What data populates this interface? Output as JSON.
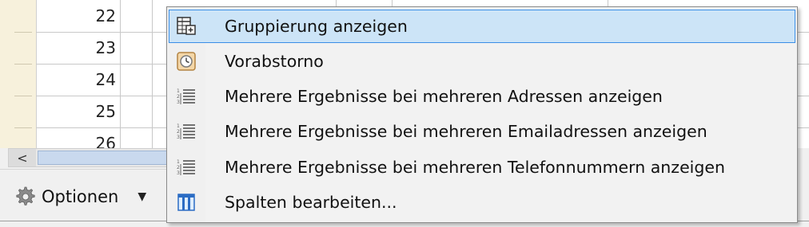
{
  "grid": {
    "rows": [
      {
        "num": "22"
      },
      {
        "num": "23"
      },
      {
        "num": "24"
      },
      {
        "num": "25"
      },
      {
        "num": "26"
      }
    ]
  },
  "toolbar": {
    "options_label": "Optionen",
    "options_icon": "gear-icon",
    "dropdown_icon": "caret-down-icon"
  },
  "scrollbar": {
    "left_arrow": "<"
  },
  "context_menu": {
    "items": [
      {
        "label": "Gruppierung anzeigen",
        "icon": "grouping-icon",
        "highlighted": true
      },
      {
        "label": "Vorabstorno",
        "icon": "storno-icon",
        "highlighted": false
      },
      {
        "label": "Mehrere Ergebnisse bei mehreren Adressen anzeigen",
        "icon": "list-icon",
        "highlighted": false
      },
      {
        "label": "Mehrere Ergebnisse bei mehreren Emailadressen anzeigen",
        "icon": "list-icon",
        "highlighted": false
      },
      {
        "label": "Mehrere Ergebnisse bei mehreren Telefonnummern anzeigen",
        "icon": "list-icon",
        "highlighted": false
      },
      {
        "label": "Spalten bearbeiten...",
        "icon": "columns-icon",
        "highlighted": false
      }
    ],
    "colors": {
      "highlight_bg": "#cce4f7",
      "highlight_border": "#3a8ee6"
    }
  }
}
